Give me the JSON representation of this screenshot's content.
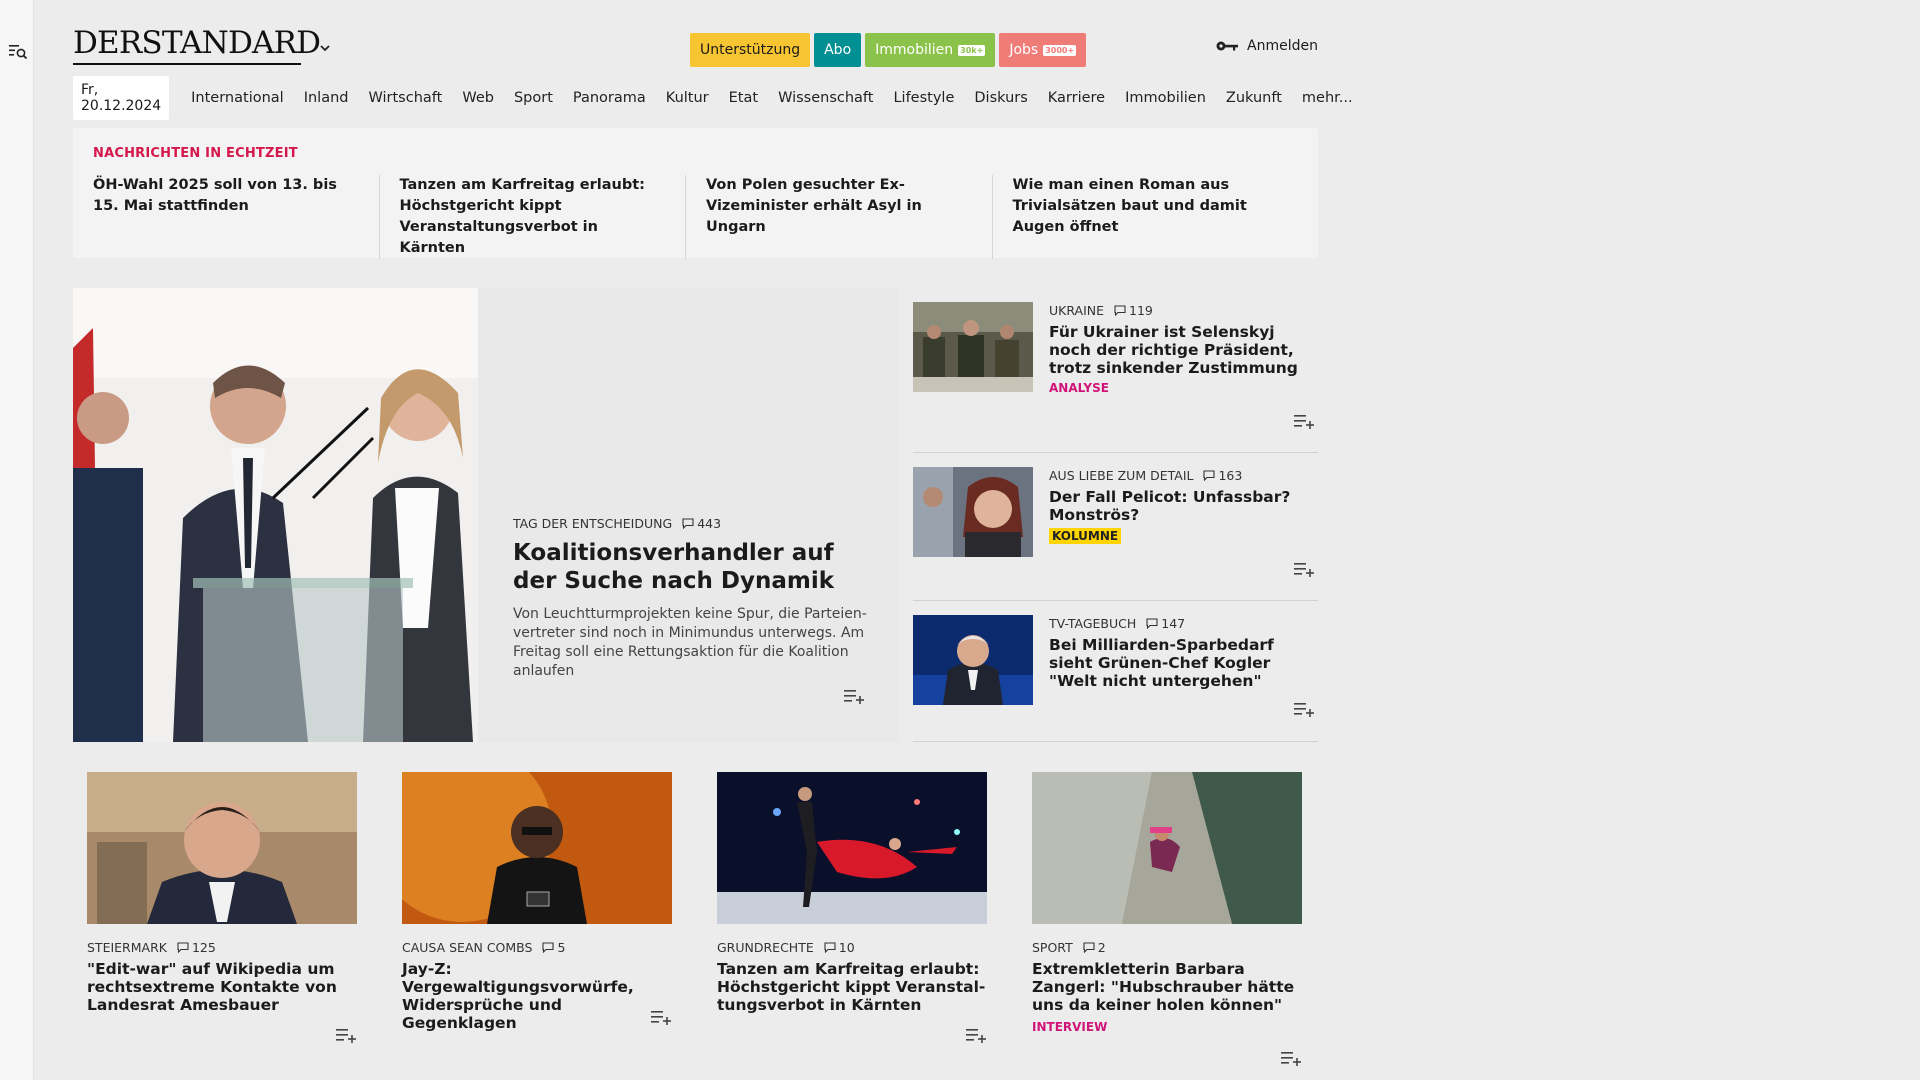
{
  "header": {
    "logo": "DERSTANDARD",
    "pills": [
      {
        "label": "Unterstützung",
        "badge": "",
        "bg": "#f7c531",
        "fg": "#1b1b1b"
      },
      {
        "label": "Abo",
        "badge": "",
        "bg": "#008f93",
        "fg": "#ffffff"
      },
      {
        "label": "Immobilien",
        "badge": "30k+",
        "bg": "#8bc34a",
        "fg": "#ffffff"
      },
      {
        "label": "Jobs",
        "badge": "3000+",
        "bg": "#f07c78",
        "fg": "#ffffff"
      }
    ],
    "login": "Anmelden"
  },
  "nav": {
    "date": "Fr, 20.12.2024",
    "items": [
      "International",
      "Inland",
      "Wirtschaft",
      "Web",
      "Sport",
      "Panorama",
      "Kultur",
      "Etat",
      "Wissenschaft",
      "Lifestyle",
      "Diskurs",
      "Karriere",
      "Immobilien",
      "Zukunft",
      "mehr..."
    ]
  },
  "ticker": {
    "title": "NACHRICHTEN IN ECHTZEIT",
    "items": [
      "ÖH-Wahl 2025 soll von 13. bis 15. Mai stattfinden",
      "Tanzen am Karfreitag erlaubt: Höchstgericht kippt Veranstaltungs­verbot in Kärnten",
      "Von Polen gesuchter Ex-Vizeminister erhält Asyl in Ungarn",
      "Wie man einen Roman aus Trivialsät­zen baut und damit Augen öffnet"
    ]
  },
  "hero": {
    "kicker": "TAG DER ENTSCHEIDUNG",
    "comments": "443",
    "title": "Koalitionsverhandler auf der Suche nach Dynamik",
    "teaser": "Von Leuchtturmprojekten keine Spur, die Parteien­vertreter sind noch in Minimundus unterwegs. Am Freitag soll eine Rettungsaktion für die Koalition anlaufen"
  },
  "side": [
    {
      "kicker": "UKRAINE",
      "comments": "119",
      "title": "Für Ukrainer ist Selenskyj noch der richtige Präsident, trotz sinkender Zustimmung",
      "label": "ANALYSE"
    },
    {
      "kicker": "AUS LIEBE ZUM DETAIL",
      "comments": "163",
      "title": "Der Fall Pelicot: Unfassbar? Monströs?",
      "label": "KOLUMNE"
    },
    {
      "kicker": "TV-TAGEBUCH",
      "comments": "147",
      "title": "Bei Milliarden-Sparbedarf sieht Grünen-Chef Kogler \"Welt nicht untergehen\"",
      "label": ""
    }
  ],
  "cards": [
    {
      "kicker": "STEIERMARK",
      "comments": "125",
      "title": "\"Edit-war\" auf Wikipedia um rechtsextreme Kontakte von Landesrat Amesbauer",
      "label": ""
    },
    {
      "kicker": "CAUSA SEAN COMBS",
      "comments": "5",
      "title": "Jay-Z: Vergewaltigungsvorwürfe, Widersprüche und Gegenklagen",
      "label": ""
    },
    {
      "kicker": "GRUNDRECHTE",
      "comments": "10",
      "title": "Tanzen am Karfreitag erlaubt: Höchstgericht kippt Veranstal­tungsverbot in Kärnten",
      "label": ""
    },
    {
      "kicker": "SPORT",
      "comments": "2",
      "title": "Extremkletterin Barbara Zangerl: \"Hubschrauber hätte uns da keiner holen können\"",
      "label": "INTERVIEW"
    }
  ]
}
